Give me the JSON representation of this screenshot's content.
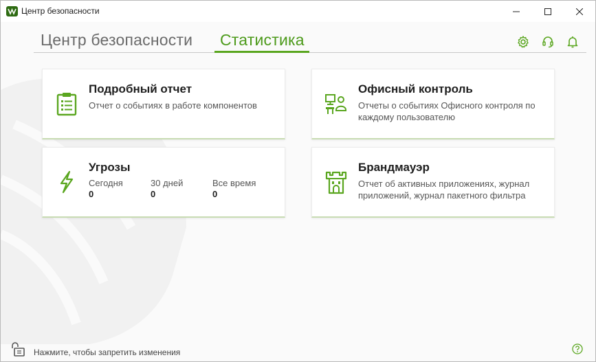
{
  "window": {
    "title": "Центр безопасности",
    "controls": {
      "minimize": "minimize-icon",
      "maximize": "maximize-icon",
      "close": "close-icon"
    }
  },
  "tabs": [
    {
      "label": "Центр безопасности",
      "active": false
    },
    {
      "label": "Статистика",
      "active": true
    }
  ],
  "header_icons": [
    "gear-icon",
    "headset-icon",
    "bell-icon"
  ],
  "colors": {
    "accent": "#5aa61f",
    "accent_text": "#4c9a1a",
    "inactive_tab": "#6a6a6a"
  },
  "cards": {
    "report": {
      "title": "Подробный отчет",
      "description": "Отчет о событиях в работе компонентов",
      "icon": "clipboard-icon"
    },
    "office": {
      "title": "Офисный контроль",
      "description": "Отчеты о событиях Офисного контроля по каждому пользователю",
      "icon": "office-control-icon"
    },
    "threats": {
      "title": "Угрозы",
      "icon": "lightning-icon",
      "stats": [
        {
          "label": "Сегодня",
          "value": "0"
        },
        {
          "label": "30 дней",
          "value": "0"
        },
        {
          "label": "Все время",
          "value": "0"
        }
      ]
    },
    "firewall": {
      "title": "Брандмауэр",
      "description": "Отчет об активных приложениях, журнал приложений, журнал пакетного фильтра",
      "icon": "castle-icon"
    }
  },
  "footer": {
    "lock_text": "Нажмите, чтобы запретить изменения",
    "lock_icon": "unlock-icon",
    "help_icon": "help-icon"
  }
}
